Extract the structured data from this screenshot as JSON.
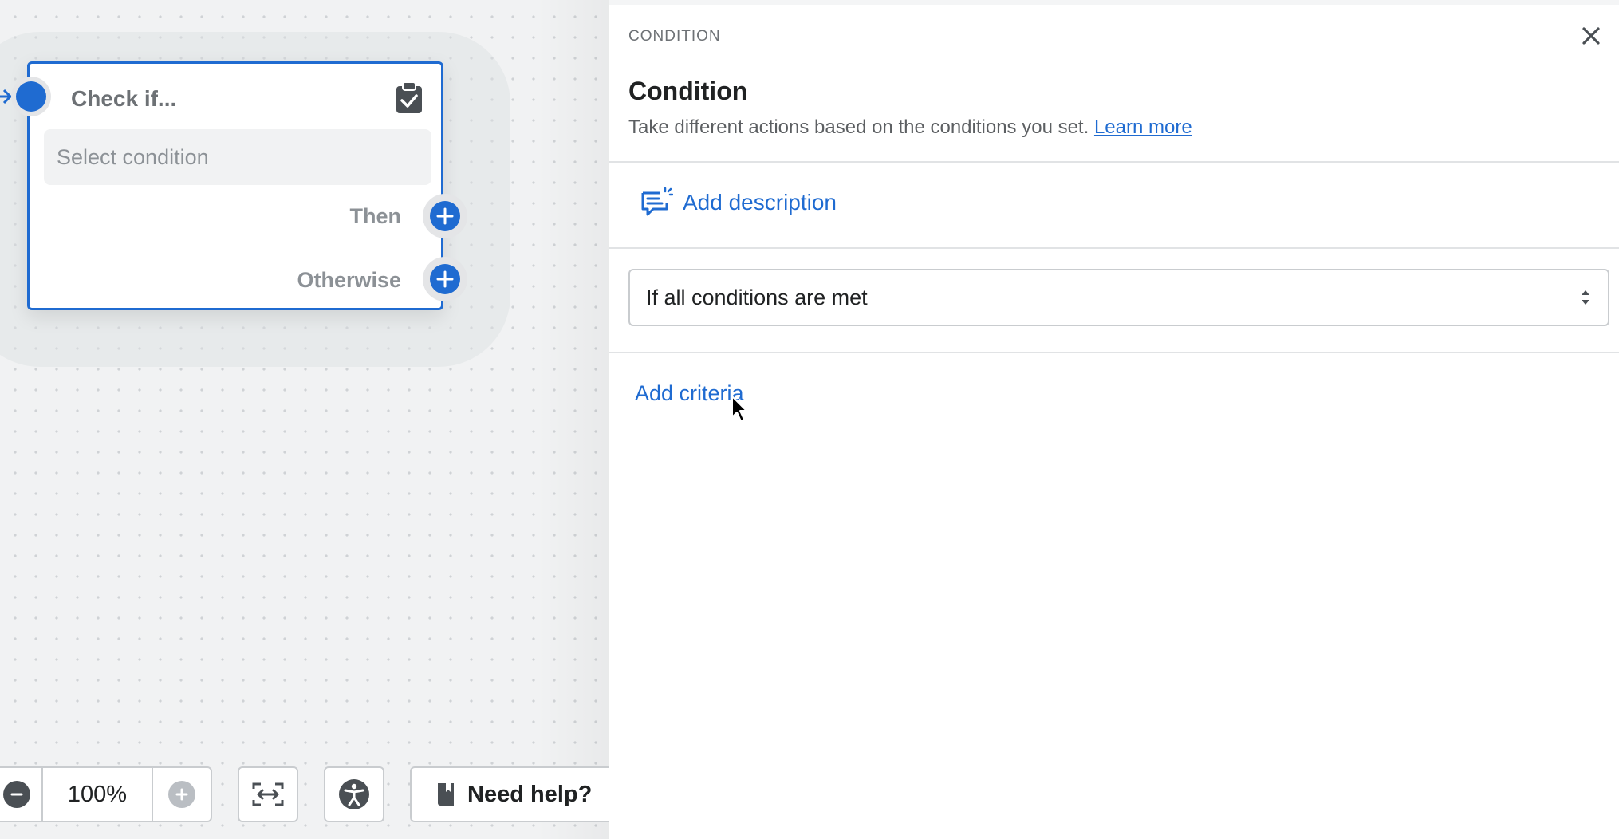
{
  "canvas": {
    "node": {
      "title": "Check if...",
      "select_placeholder": "Select condition",
      "branches": {
        "then": "Then",
        "otherwise": "Otherwise"
      },
      "badge_icon": "clipboard-check-icon"
    },
    "toolbar": {
      "zoom_level": "100%",
      "need_help_label": "Need help?"
    }
  },
  "panel": {
    "eyebrow": "CONDITION",
    "title": "Condition",
    "description": "Take different actions based on the conditions you set.",
    "learn_more": "Learn more",
    "add_description": "Add description",
    "condition_mode": "If all conditions are met",
    "add_criteria": "Add criteria"
  },
  "colors": {
    "accent": "#1f6bd1",
    "text": "#202223",
    "muted": "#8c9196"
  }
}
